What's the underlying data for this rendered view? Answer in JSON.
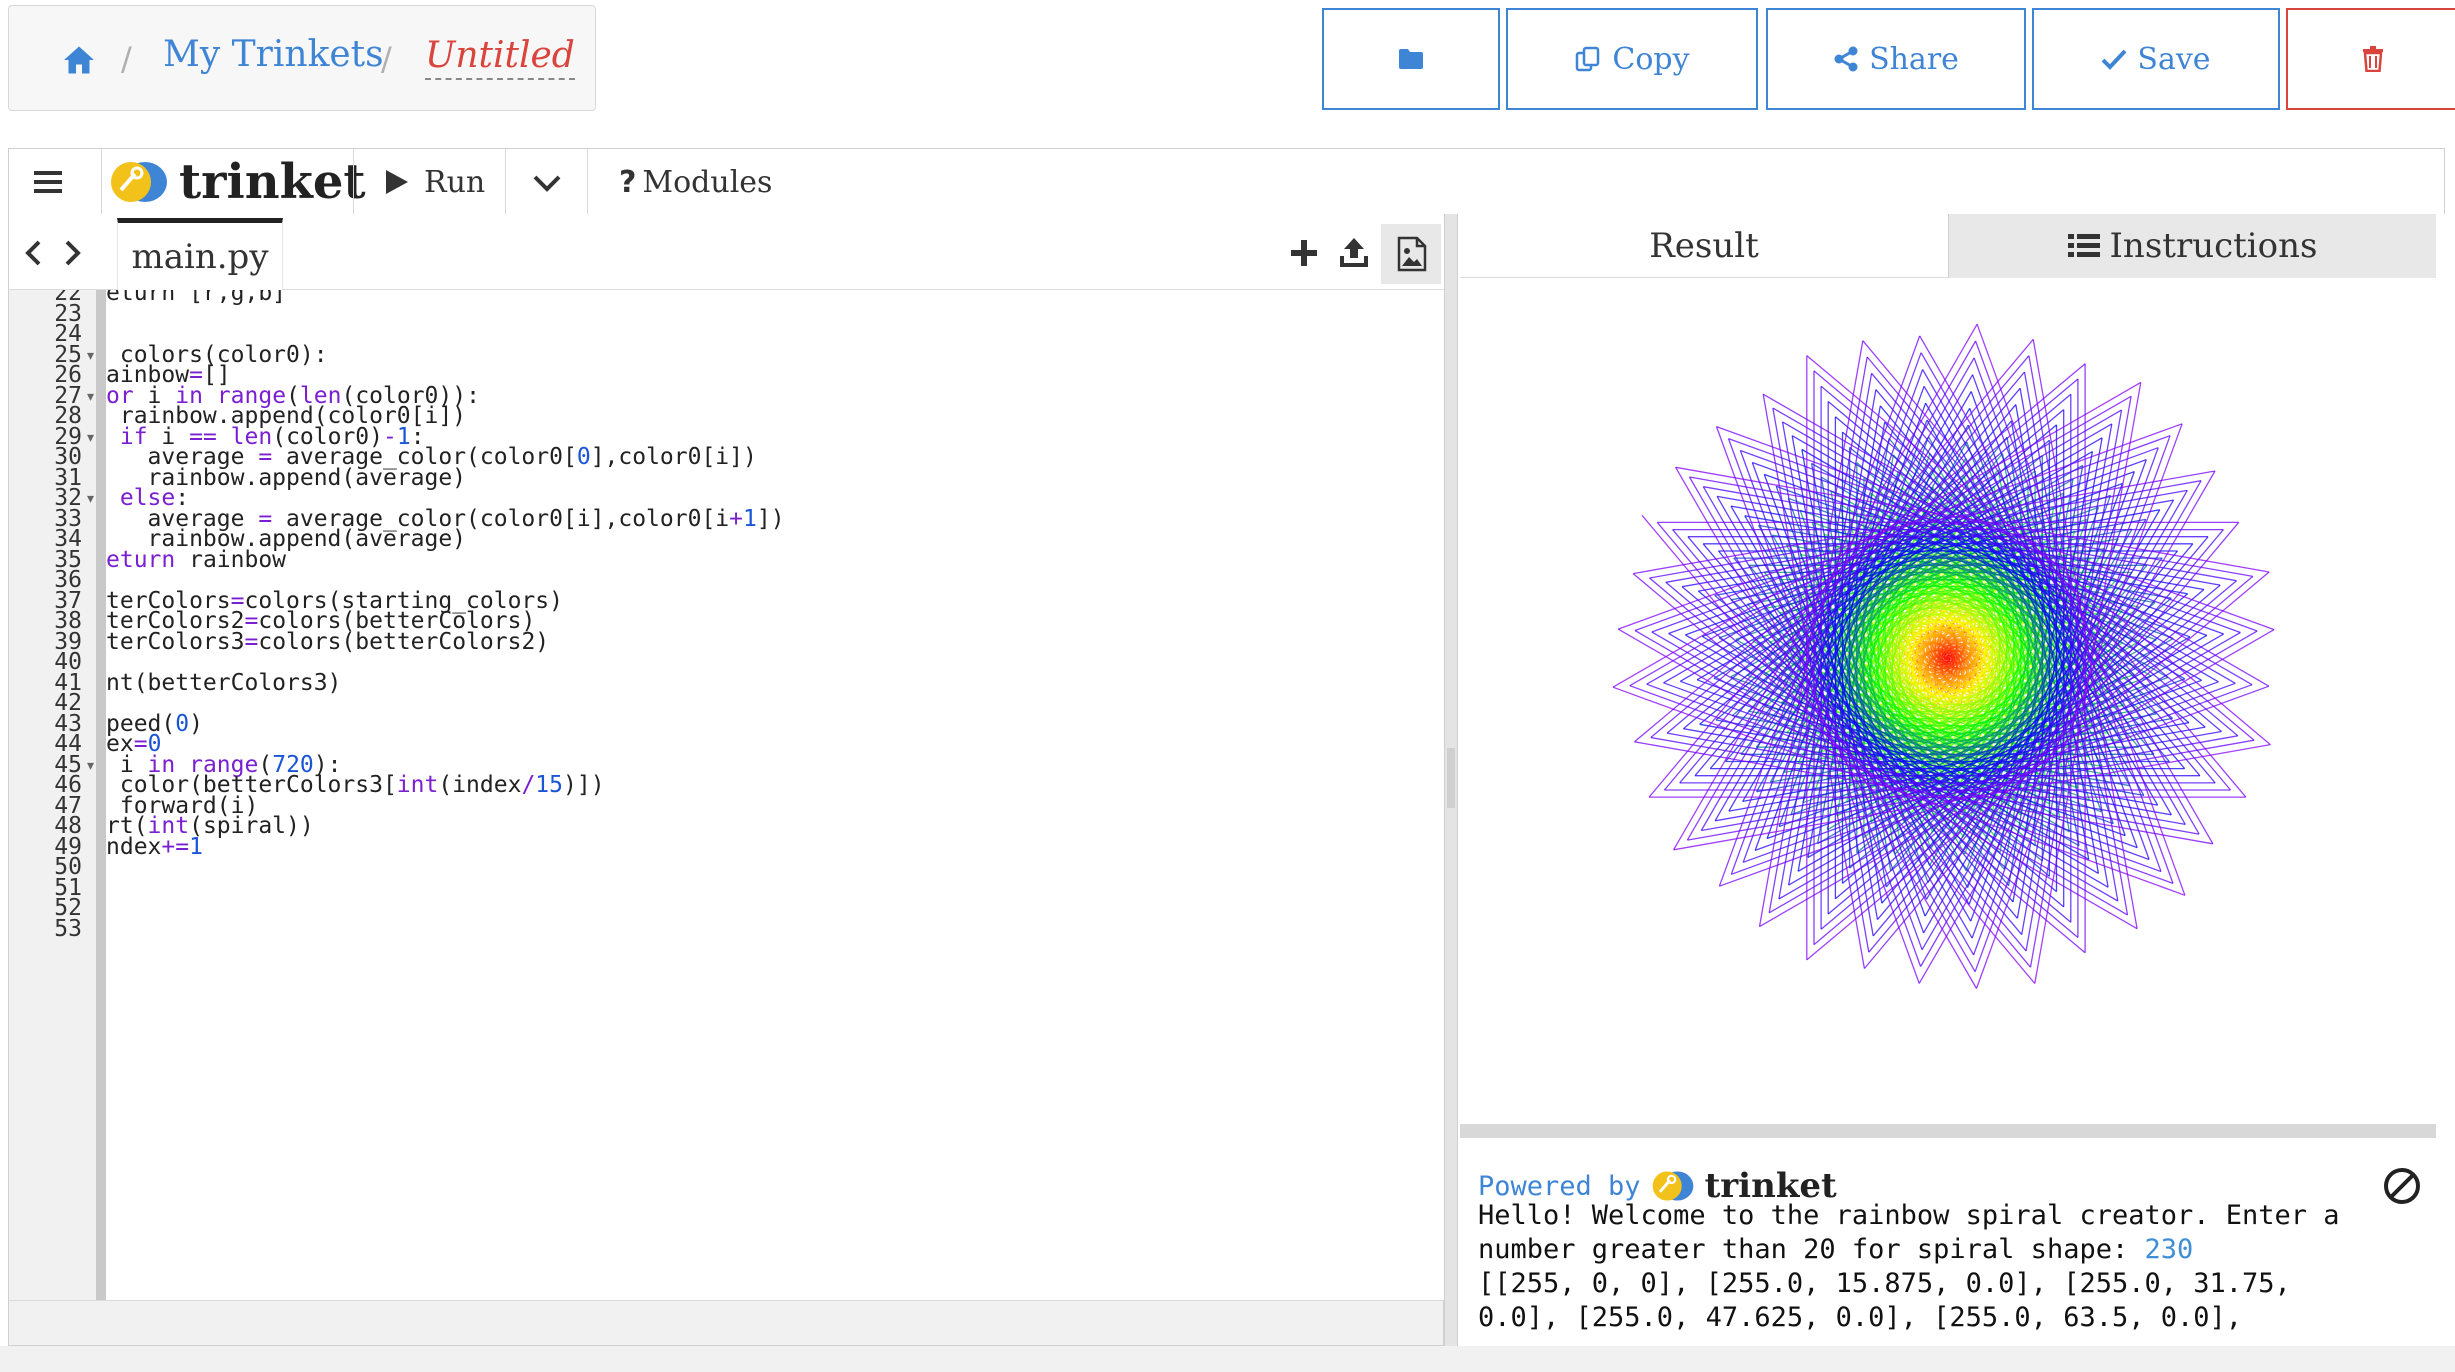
{
  "breadcrumb": {
    "parent": "My Trinkets",
    "current": "Untitled",
    "separator": "/"
  },
  "topbar": {
    "open_icon": "folder-icon",
    "copy_label": "Copy",
    "share_label": "Share",
    "save_label": "Save",
    "delete_icon": "trash-icon"
  },
  "toolbar": {
    "brand": "trinket",
    "run_label": "Run",
    "modules_label": "Modules"
  },
  "editor": {
    "file_name": "main.py",
    "lines": [
      {
        "n": "22",
        "fold": false,
        "segs": [
          [
            "t",
            "eturn [r,g,b]"
          ]
        ]
      },
      {
        "n": "23",
        "fold": false,
        "segs": []
      },
      {
        "n": "24",
        "fold": false,
        "segs": []
      },
      {
        "n": "25",
        "fold": true,
        "segs": [
          [
            "t",
            " colors(color0):"
          ]
        ]
      },
      {
        "n": "26",
        "fold": false,
        "segs": [
          [
            "t",
            "ainbow"
          ],
          [
            "op",
            "="
          ],
          [
            "t",
            "[]"
          ]
        ]
      },
      {
        "n": "27",
        "fold": true,
        "segs": [
          [
            "kw",
            "or"
          ],
          [
            "t",
            " i "
          ],
          [
            "kw",
            "in"
          ],
          [
            "t",
            " "
          ],
          [
            "kw",
            "range"
          ],
          [
            "t",
            "("
          ],
          [
            "kw",
            "len"
          ],
          [
            "t",
            "(color0)):"
          ]
        ]
      },
      {
        "n": "28",
        "fold": false,
        "segs": [
          [
            "t",
            " rainbow.append(color0[i])"
          ]
        ]
      },
      {
        "n": "29",
        "fold": true,
        "segs": [
          [
            "t",
            " "
          ],
          [
            "kw",
            "if"
          ],
          [
            "t",
            " i "
          ],
          [
            "op",
            "=="
          ],
          [
            "t",
            " "
          ],
          [
            "kw",
            "len"
          ],
          [
            "t",
            "(color0)"
          ],
          [
            "op",
            "-"
          ],
          [
            "num",
            "1"
          ],
          [
            "t",
            ":"
          ]
        ]
      },
      {
        "n": "30",
        "fold": false,
        "segs": [
          [
            "t",
            "   average "
          ],
          [
            "op",
            "="
          ],
          [
            "t",
            " average_color(color0["
          ],
          [
            "num",
            "0"
          ],
          [
            "t",
            "],color0[i])"
          ]
        ]
      },
      {
        "n": "31",
        "fold": false,
        "segs": [
          [
            "t",
            "   rainbow.append(average)"
          ]
        ]
      },
      {
        "n": "32",
        "fold": true,
        "segs": [
          [
            "t",
            " "
          ],
          [
            "kw",
            "else"
          ],
          [
            "t",
            ":"
          ]
        ]
      },
      {
        "n": "33",
        "fold": false,
        "segs": [
          [
            "t",
            "   average "
          ],
          [
            "op",
            "="
          ],
          [
            "t",
            " average_color(color0[i],color0[i"
          ],
          [
            "op",
            "+"
          ],
          [
            "num",
            "1"
          ],
          [
            "t",
            "])"
          ]
        ]
      },
      {
        "n": "34",
        "fold": false,
        "segs": [
          [
            "t",
            "   rainbow.append(average)"
          ]
        ]
      },
      {
        "n": "35",
        "fold": false,
        "segs": [
          [
            "kw",
            "eturn"
          ],
          [
            "t",
            " rainbow"
          ]
        ]
      },
      {
        "n": "36",
        "fold": false,
        "segs": []
      },
      {
        "n": "37",
        "fold": false,
        "segs": [
          [
            "t",
            "terColors"
          ],
          [
            "op",
            "="
          ],
          [
            "t",
            "colors(starting_colors)"
          ]
        ]
      },
      {
        "n": "38",
        "fold": false,
        "segs": [
          [
            "t",
            "terColors2"
          ],
          [
            "op",
            "="
          ],
          [
            "t",
            "colors(betterColors)"
          ]
        ]
      },
      {
        "n": "39",
        "fold": false,
        "segs": [
          [
            "t",
            "terColors3"
          ],
          [
            "op",
            "="
          ],
          [
            "t",
            "colors(betterColors2)"
          ]
        ]
      },
      {
        "n": "40",
        "fold": false,
        "segs": []
      },
      {
        "n": "41",
        "fold": false,
        "segs": [
          [
            "t",
            "nt(betterColors3)"
          ]
        ]
      },
      {
        "n": "42",
        "fold": false,
        "segs": []
      },
      {
        "n": "43",
        "fold": false,
        "segs": [
          [
            "t",
            "peed("
          ],
          [
            "num",
            "0"
          ],
          [
            "t",
            ")"
          ]
        ]
      },
      {
        "n": "44",
        "fold": false,
        "segs": [
          [
            "t",
            "ex"
          ],
          [
            "op",
            "="
          ],
          [
            "num",
            "0"
          ]
        ]
      },
      {
        "n": "45",
        "fold": true,
        "segs": [
          [
            "t",
            " i "
          ],
          [
            "kw",
            "in"
          ],
          [
            "t",
            " "
          ],
          [
            "kw",
            "range"
          ],
          [
            "t",
            "("
          ],
          [
            "num",
            "720"
          ],
          [
            "t",
            "):"
          ]
        ]
      },
      {
        "n": "46",
        "fold": false,
        "segs": [
          [
            "t",
            " color(betterColors3["
          ],
          [
            "kw",
            "int"
          ],
          [
            "t",
            "(index"
          ],
          [
            "op",
            "/"
          ],
          [
            "num",
            "15"
          ],
          [
            "t",
            ")])"
          ]
        ]
      },
      {
        "n": "47",
        "fold": false,
        "segs": [
          [
            "t",
            " forward(i)"
          ]
        ]
      },
      {
        "n": "48",
        "fold": false,
        "segs": [
          [
            "t",
            "rt("
          ],
          [
            "kw",
            "int"
          ],
          [
            "t",
            "(spiral))"
          ]
        ]
      },
      {
        "n": "49",
        "fold": false,
        "segs": [
          [
            "t",
            "ndex"
          ],
          [
            "op",
            "+="
          ],
          [
            "num",
            "1"
          ]
        ]
      },
      {
        "n": "50",
        "fold": false,
        "segs": []
      },
      {
        "n": "51",
        "fold": false,
        "segs": []
      },
      {
        "n": "52",
        "fold": false,
        "segs": []
      },
      {
        "n": "53",
        "fold": false,
        "segs": []
      }
    ]
  },
  "result": {
    "tab_result": "Result",
    "tab_instructions": "Instructions",
    "console": {
      "powered_by": "Powered by",
      "brand": "trinket",
      "lines": [
        "Hello! Welcome to the rainbow spiral creator. Enter a",
        "number greater than 20 for spiral shape: ",
        "[[255, 0, 0], [255.0, 15.875, 0.0], [255.0, 31.75,",
        "0.0], [255.0, 47.625, 0.0], [255.0, 63.5, 0.0],"
      ],
      "input_value": "230"
    }
  },
  "colors": {
    "accent": "#3f85d6",
    "danger": "#d9443c",
    "keyword": "#7a1fd1",
    "number": "#1a55d6"
  }
}
